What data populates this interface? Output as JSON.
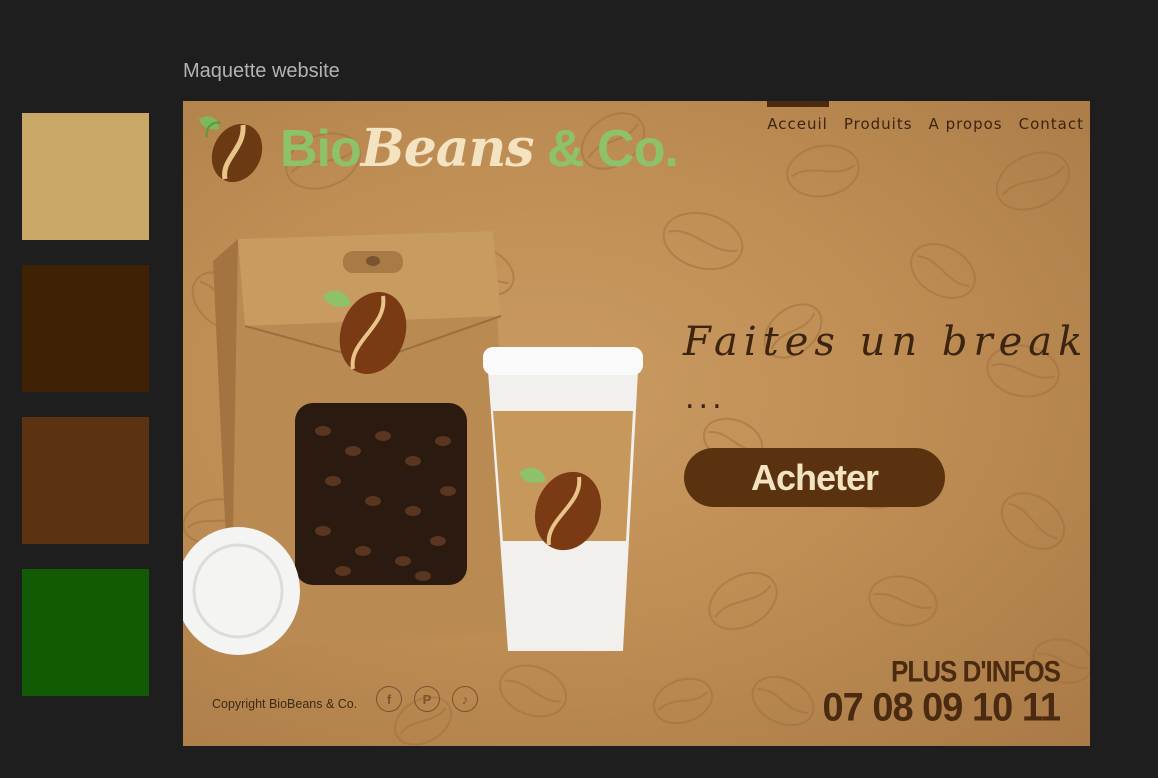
{
  "frame": {
    "title": "Maquette website"
  },
  "palette": [
    "#c9a766",
    "#3f2206",
    "#5c3210",
    "#125a03"
  ],
  "site": {
    "logo": {
      "bio": "Bio",
      "beans": "Beans",
      "co": "& Co.",
      "icon": "coffee-bean-leaf-icon"
    },
    "nav": [
      "Acceuil",
      "Produits",
      "A propos",
      "Contact"
    ],
    "active_nav": "Acceuil",
    "hero": {
      "headline": "Faites un break",
      "ellipsis": "...",
      "button_label": "Acheter"
    },
    "footer": {
      "copyright": "Copyright BioBeans & Co.",
      "socials": [
        "facebook-icon",
        "pinterest-icon",
        "tiktok-icon"
      ],
      "info_label": "PLUS D'INFOS",
      "phone": "07 08 09 10 11"
    },
    "colors": {
      "background": "#c08f57",
      "text_dark": "#3b2410",
      "button": "#5a3210",
      "logo_green": "#8dc16a",
      "logo_cream": "#f4e3c0"
    }
  }
}
